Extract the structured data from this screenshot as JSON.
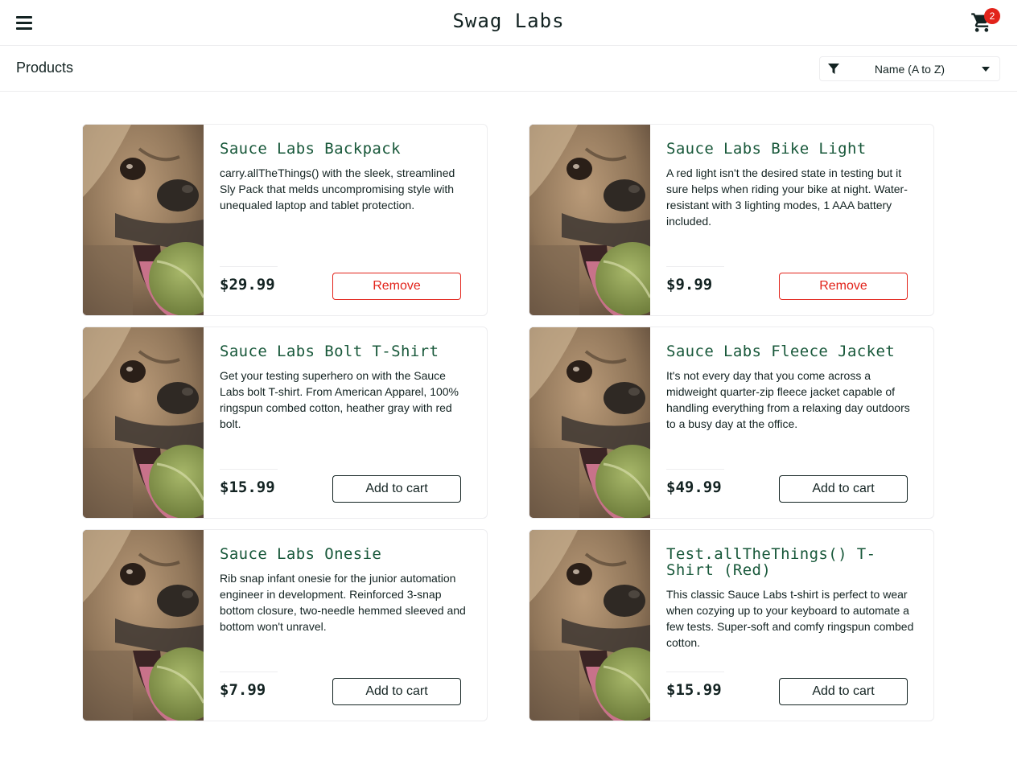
{
  "header": {
    "app_logo": "Swag Labs",
    "cart_badge": "2"
  },
  "subheader": {
    "title": "Products",
    "sort_selected": "Name (A to Z)"
  },
  "products": [
    {
      "name": "Sauce Labs Backpack",
      "description": "carry.allTheThings() with the sleek, streamlined Sly Pack that melds uncompromising style with unequaled laptop and tablet protection.",
      "price": "$29.99",
      "button": "Remove",
      "in_cart": true
    },
    {
      "name": "Sauce Labs Bike Light",
      "description": "A red light isn't the desired state in testing but it sure helps when riding your bike at night. Water-resistant with 3 lighting modes, 1 AAA battery included.",
      "price": "$9.99",
      "button": "Remove",
      "in_cart": true
    },
    {
      "name": "Sauce Labs Bolt T-Shirt",
      "description": "Get your testing superhero on with the Sauce Labs bolt T-shirt. From American Apparel, 100% ringspun combed cotton, heather gray with red bolt.",
      "price": "$15.99",
      "button": "Add to cart",
      "in_cart": false
    },
    {
      "name": "Sauce Labs Fleece Jacket",
      "description": "It's not every day that you come across a midweight quarter-zip fleece jacket capable of handling everything from a relaxing day outdoors to a busy day at the office.",
      "price": "$49.99",
      "button": "Add to cart",
      "in_cart": false
    },
    {
      "name": "Sauce Labs Onesie",
      "description": "Rib snap infant onesie for the junior automation engineer in development. Reinforced 3-snap bottom closure, two-needle hemmed sleeved and bottom won't unravel.",
      "price": "$7.99",
      "button": "Add to cart",
      "in_cart": false
    },
    {
      "name": "Test.allTheThings() T-Shirt (Red)",
      "description": "This classic Sauce Labs t-shirt is perfect to wear when cozying up to your keyboard to automate a few tests. Super-soft and comfy ringspun combed cotton.",
      "price": "$15.99",
      "button": "Add to cart",
      "in_cart": false
    }
  ],
  "icons": {
    "menu": "hamburger-menu-icon",
    "cart": "shopping-cart-icon",
    "sort_filter": "filter-icon",
    "sort_caret": "caret-down-icon",
    "product_image": "pug-with-tennis-ball-image"
  },
  "colors": {
    "product_name": "#18583a",
    "remove": "#e2231a",
    "badge": "#e2231a",
    "text": "#132322",
    "border": "#ededef"
  }
}
